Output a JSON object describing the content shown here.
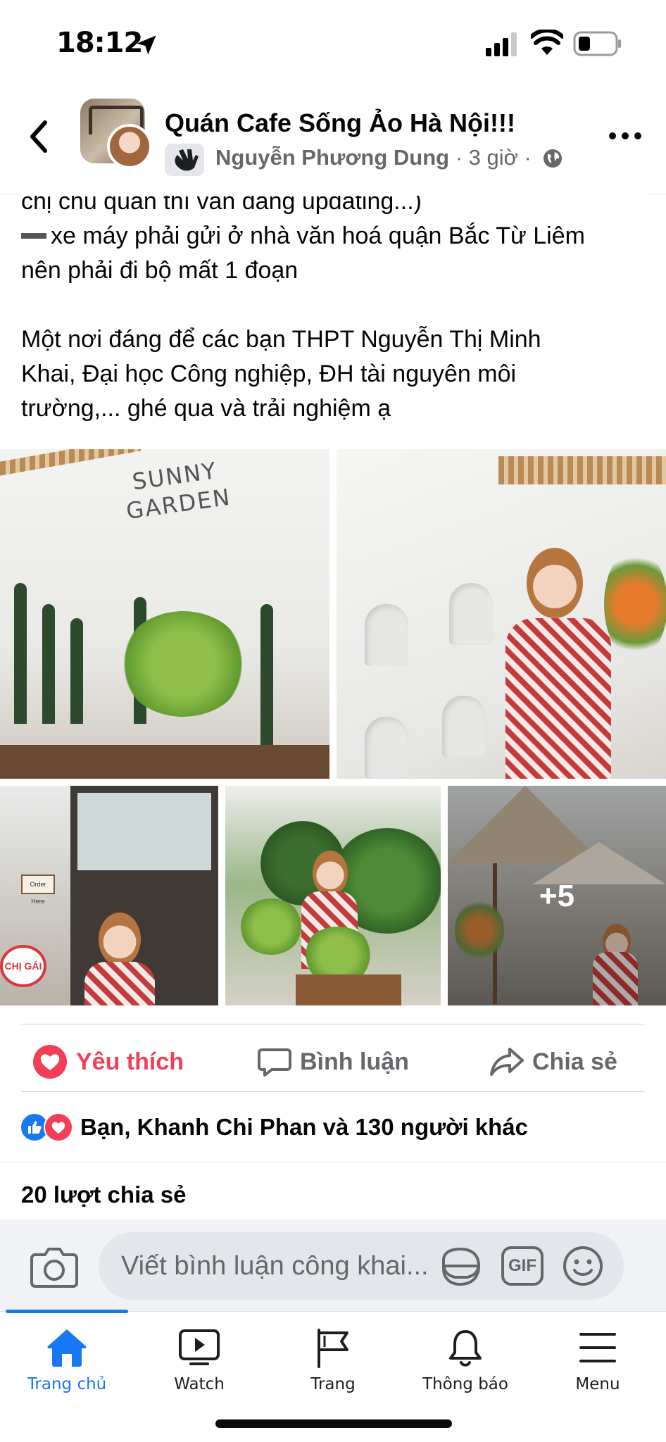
{
  "status_bar": {
    "time": "18:12"
  },
  "header": {
    "group_name": "Quán Cafe Sống Ảo Hà Nội!!!",
    "author": "Nguyễn Phương Dung",
    "time_ago": " · 3 giờ ·"
  },
  "post": {
    "lines": [
      "chị chủ quán thì vẫn đang updating...)",
      "xe máy phải gửi ở nhà văn hoá quận Bắc Từ Liêm",
      "nên phải đi bộ mất 1 đoạn",
      "Một nơi đáng để các bạn THPT Nguyễn Thị Minh",
      "Khai, Đại học Công nghiệp, ĐH tài nguyên môi",
      "trường,... ghé qua và trải nghiệm ạ"
    ]
  },
  "photos": {
    "sign_line1": "SUNNY",
    "sign_line2": "GARDEN",
    "order_sign": "Order Here",
    "stall_sign": "CHỊ GÁI",
    "more_count": "+5"
  },
  "actions": {
    "like_label": "Yêu thích",
    "comment_label": "Bình luận",
    "share_label": "Chia sẻ"
  },
  "reactions": {
    "summary": "Bạn, Khanh Chi Phan và 130 người khác"
  },
  "shares": {
    "text": "20 lượt chia sẻ"
  },
  "comment_box": {
    "placeholder": "Viết bình luận công khai...",
    "gif_label": "GIF"
  },
  "tabs": [
    {
      "label": "Trang chủ",
      "active": true
    },
    {
      "label": "Watch"
    },
    {
      "label": "Trang"
    },
    {
      "label": "Thông báo"
    },
    {
      "label": "Menu"
    }
  ],
  "colors": {
    "accent": "#1877f2",
    "love": "#f33e58",
    "muted": "#65676b"
  },
  "icons": [
    "location-arrow-icon",
    "signal-icon",
    "wifi-icon",
    "battery-icon",
    "back-icon",
    "globe-icon",
    "more-icon",
    "heart-icon",
    "comment-icon",
    "share-icon",
    "like-reaction-icon",
    "love-reaction-icon",
    "camera-icon",
    "sticker-icon",
    "gif-icon",
    "emoji-icon",
    "home-icon",
    "watch-icon",
    "flag-icon",
    "bell-icon",
    "menu-icon"
  ]
}
